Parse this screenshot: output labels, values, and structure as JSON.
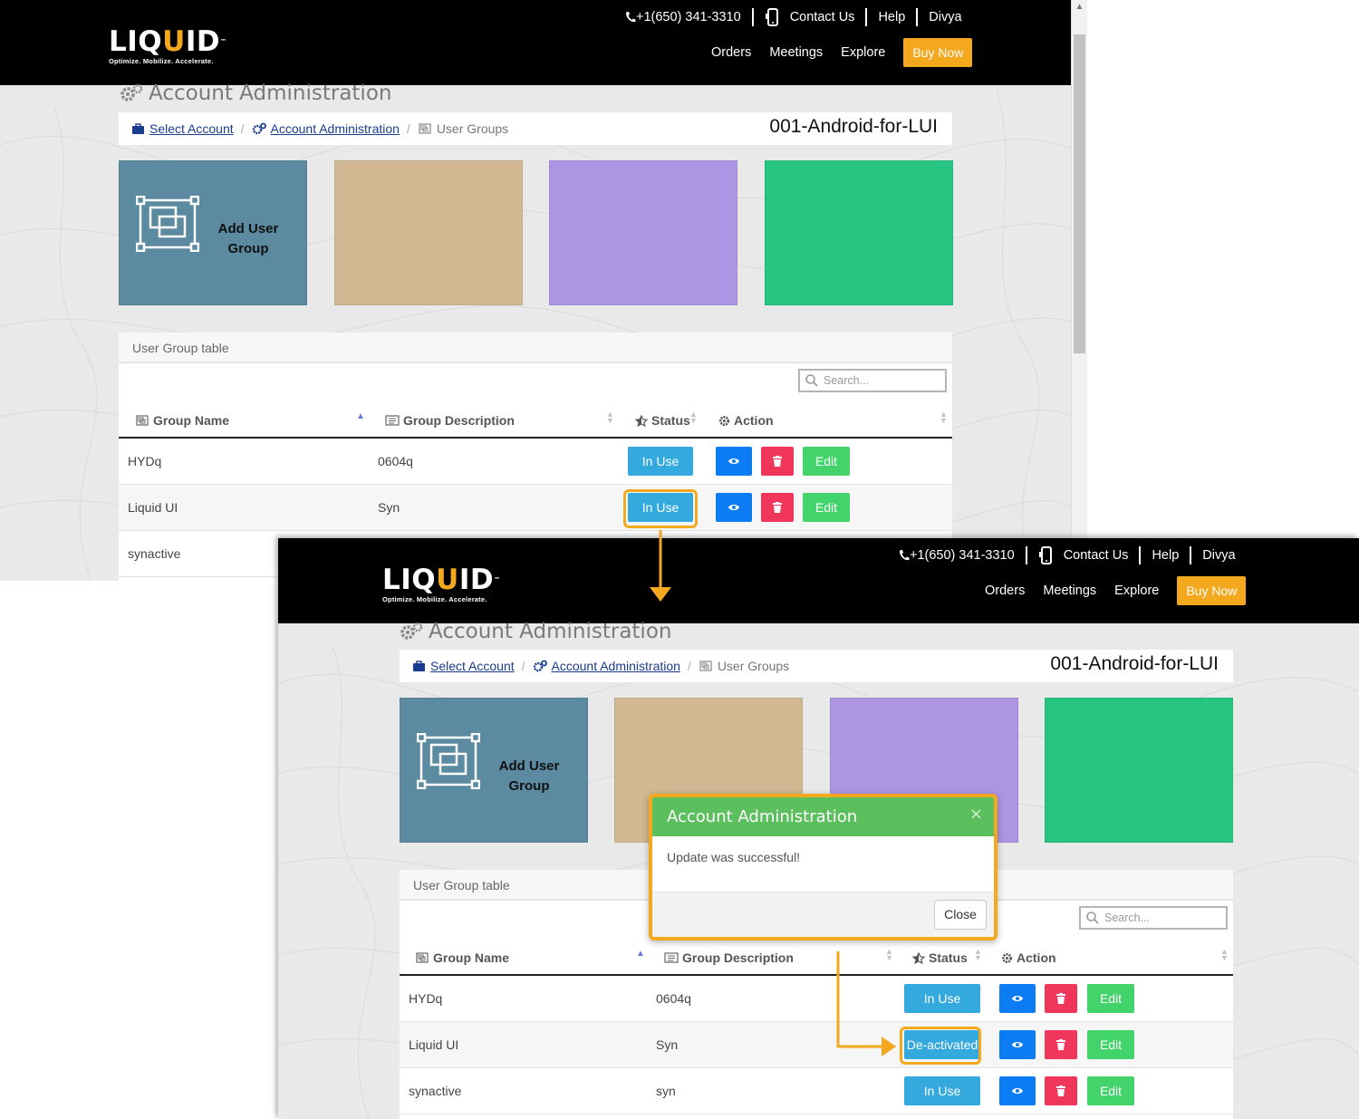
{
  "header": {
    "logo_word_a": "LIQ",
    "logo_word_u": "U",
    "logo_word_b": "ID",
    "logo_tm": "™",
    "logo_tagline": "Optimize. Mobilize. Accelerate.",
    "phone": "+1(650) 341-3310",
    "contact": "Contact Us",
    "help": "Help",
    "user": "Divya",
    "nav_orders": "Orders",
    "nav_meetings": "Meetings",
    "nav_explore": "Explore",
    "buy_now": "Buy Now"
  },
  "page": {
    "title": "Account Administration",
    "crumb_select_account": "Select Account",
    "crumb_account_admin": "Account Administration",
    "crumb_user_groups": "User Groups",
    "crumb_sep": "/",
    "account_name": "001-Android-for-LUI"
  },
  "tiles": {
    "add_user_group_line1": "Add User",
    "add_user_group_line2": "Group",
    "colors": [
      "#5b8aa1",
      "#d2b994",
      "#ae95e3",
      "#27c581"
    ]
  },
  "table": {
    "caption": "User Group table",
    "search_placeholder": "Search...",
    "col_group_name": "Group Name",
    "col_group_desc": "Group Description",
    "col_status": "Status",
    "col_action": "Action",
    "edit_label": "Edit",
    "before_rows": [
      {
        "name": "HYDq",
        "desc": "0604q",
        "status": "In Use"
      },
      {
        "name": "Liquid UI",
        "desc": "Syn",
        "status": "In Use"
      },
      {
        "name": "synactive",
        "desc": "",
        "status": ""
      }
    ],
    "after_rows": [
      {
        "name": "HYDq",
        "desc": "0604q",
        "status": "In Use"
      },
      {
        "name": "Liquid UI",
        "desc": "Syn",
        "status": "De-activated"
      },
      {
        "name": "synactive",
        "desc": "syn",
        "status": "In Use"
      }
    ]
  },
  "modal": {
    "title": "Account Administration",
    "close_x": "×",
    "message": "Update was successful!",
    "close_button": "Close"
  },
  "colors": {
    "accent_highlight": "#f4a81d",
    "status_button": "#33a9dd",
    "view_button": "#0b7cf3",
    "delete_button": "#f0365a",
    "edit_button": "#43d36b",
    "modal_header": "#5cbf5e"
  }
}
